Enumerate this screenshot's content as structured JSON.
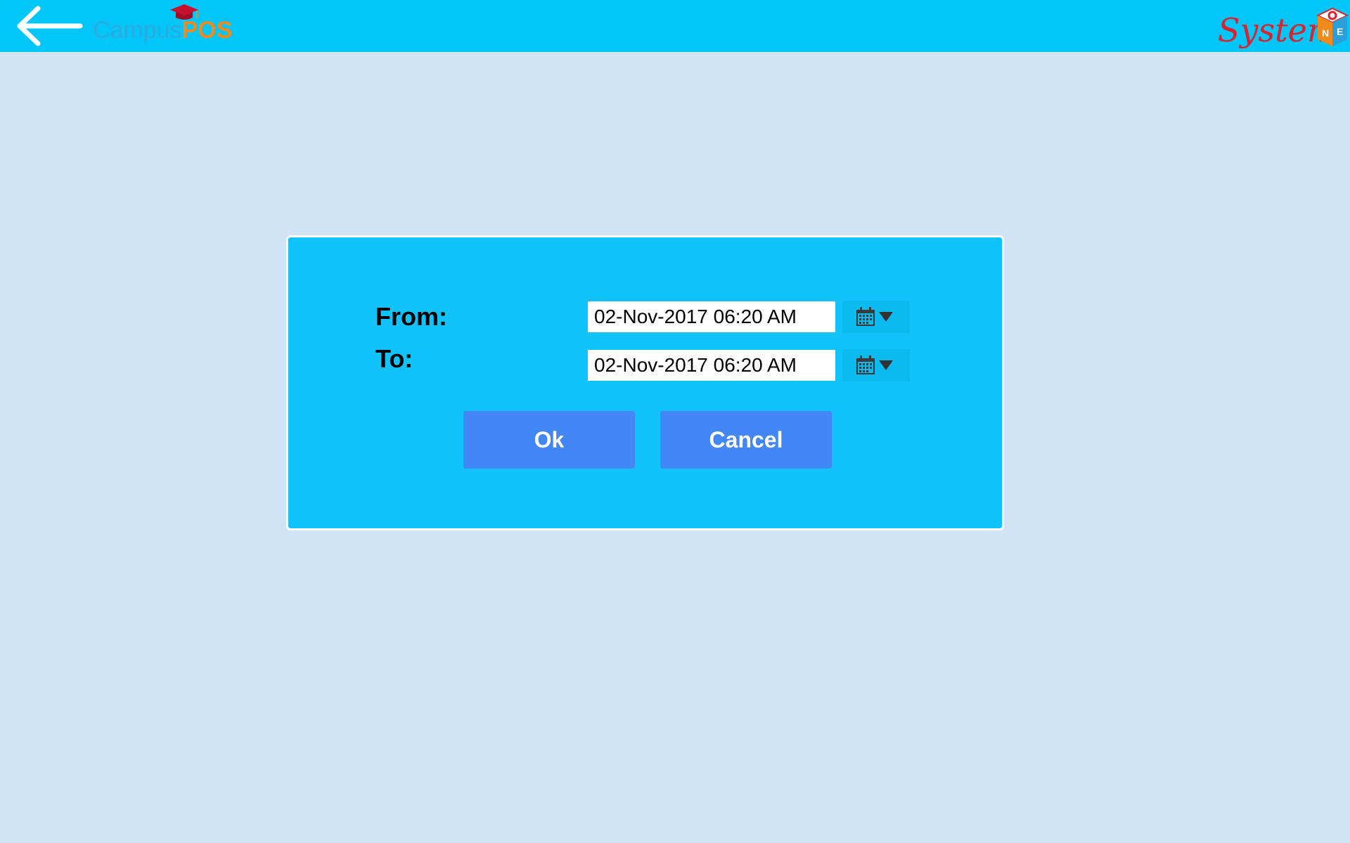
{
  "header": {
    "back_icon": "arrow-left-icon",
    "campus_logo": {
      "campus_text": "Campus",
      "pos_text": "POS",
      "icon": "graduation-cap-icon"
    },
    "brand_logo": {
      "text": "System",
      "icon": "cube-logo-icon"
    }
  },
  "dialog": {
    "from_label": "From:",
    "to_label": "To:",
    "from_value": "02-Nov-2017 06:20 AM",
    "to_value": "02-Nov-2017 06:20 AM",
    "picker_icon": "calendar-icon",
    "dropdown_icon": "caret-down-icon",
    "ok_label": "Ok",
    "cancel_label": "Cancel"
  },
  "colors": {
    "topbar": "#00c6fa",
    "background": "#d1e4f5",
    "dialog": "#12c3fb",
    "button": "#4287f5",
    "campus_accent": "#f08a1c",
    "brand_red": "#d9232e"
  }
}
